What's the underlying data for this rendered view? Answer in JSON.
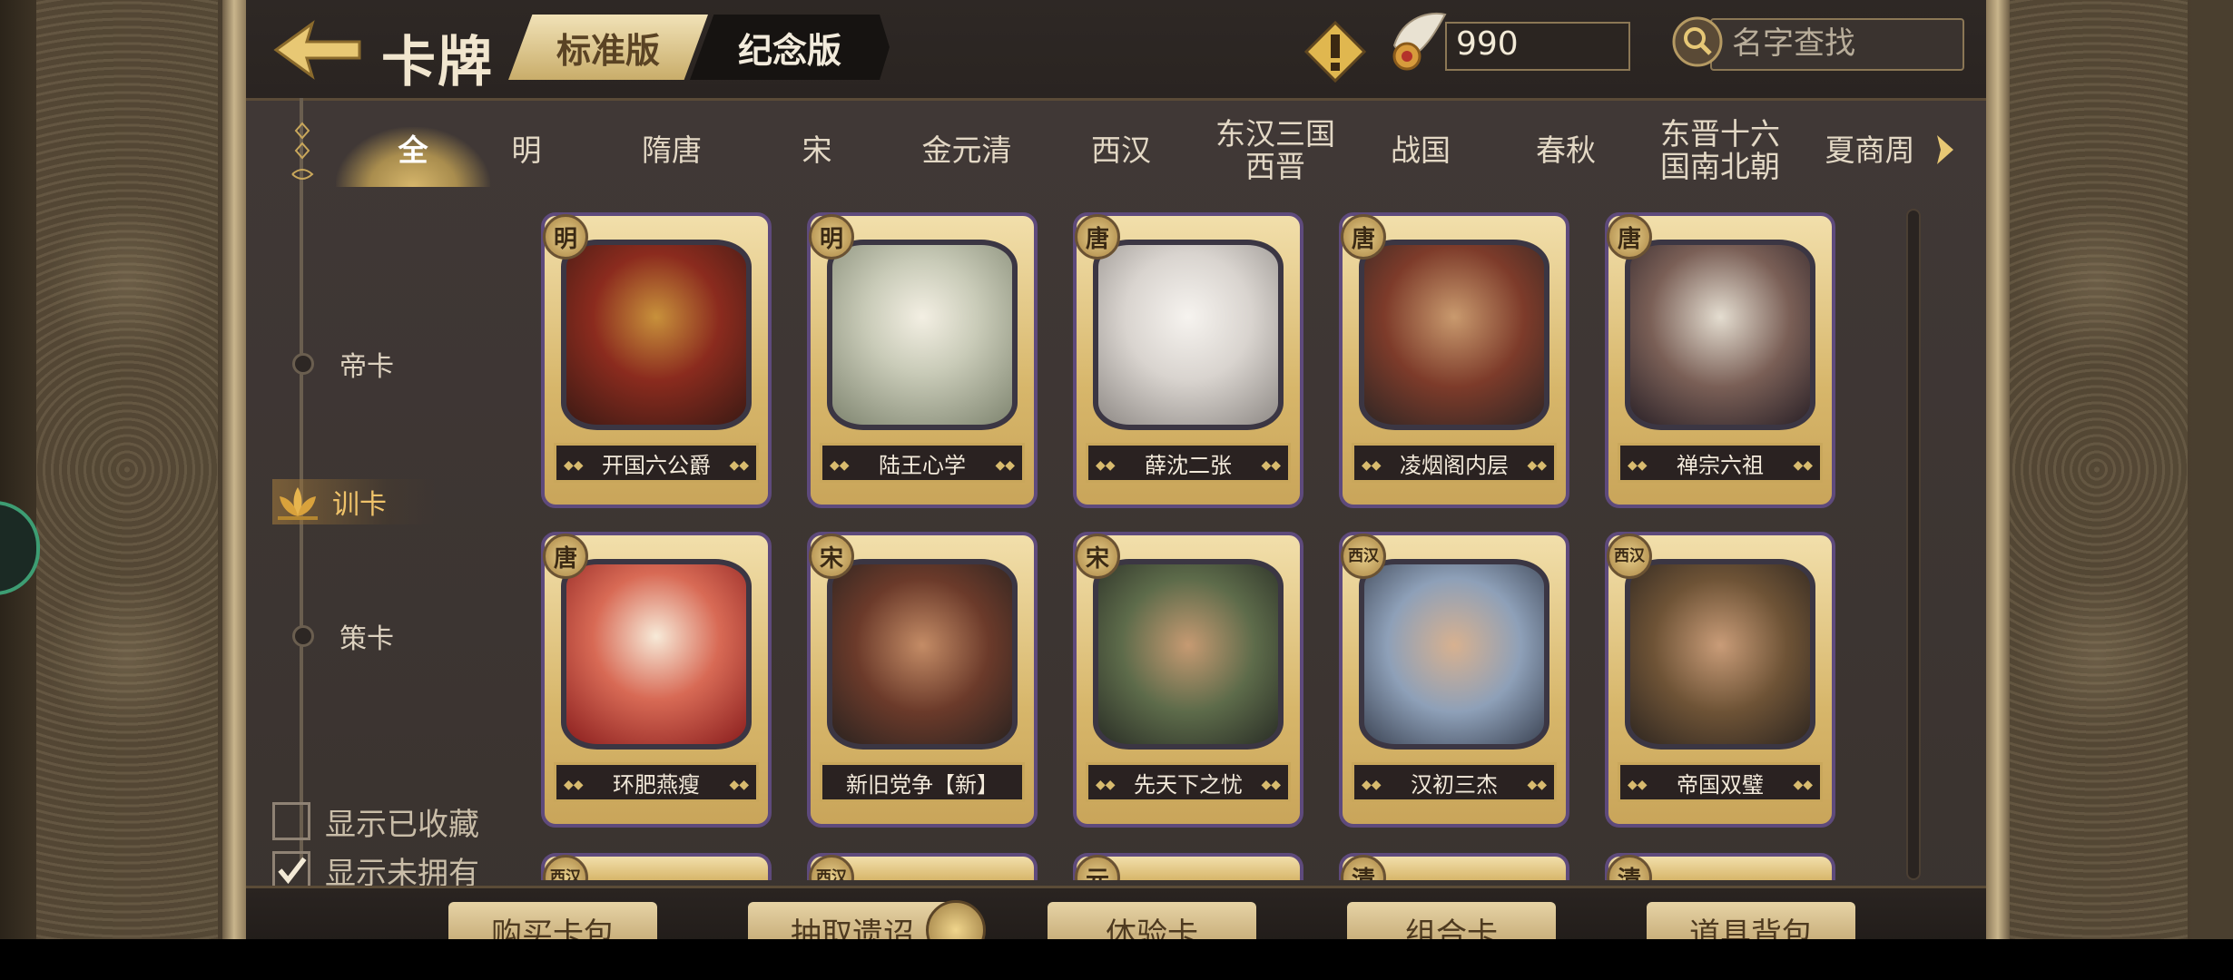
{
  "header": {
    "title": "卡牌",
    "version_tabs": [
      {
        "label": "标准版",
        "active": true
      },
      {
        "label": "纪念版",
        "active": false
      }
    ],
    "currency_value": "990",
    "search_placeholder": "名字查找"
  },
  "eras": [
    {
      "label": "全",
      "active": true
    },
    {
      "label": "明"
    },
    {
      "label": "隋唐"
    },
    {
      "label": "宋"
    },
    {
      "label": "金元清"
    },
    {
      "label": "西汉"
    },
    {
      "label": "东汉三国\n西晋"
    },
    {
      "label": "战国"
    },
    {
      "label": "春秋"
    },
    {
      "label": "东晋十六\n国南北朝"
    },
    {
      "label": "夏商周"
    }
  ],
  "sidebar": {
    "categories": [
      {
        "label": "帝卡",
        "active": false
      },
      {
        "label": "训卡",
        "active": true
      },
      {
        "label": "策卡",
        "active": false
      }
    ],
    "checkboxes": [
      {
        "label": "显示已收藏",
        "checked": false
      },
      {
        "label": "显示未拥有",
        "checked": true
      }
    ]
  },
  "cards": [
    {
      "badge": "明",
      "name": "开国六公爵"
    },
    {
      "badge": "明",
      "name": "陆王心学"
    },
    {
      "badge": "唐",
      "name": "薛沈二张"
    },
    {
      "badge": "唐",
      "name": "凌烟阁内层"
    },
    {
      "badge": "唐",
      "name": "禅宗六祖"
    },
    {
      "badge": "唐",
      "name": "环肥燕瘦"
    },
    {
      "badge": "宋",
      "name": "新旧党争【新】"
    },
    {
      "badge": "宋",
      "name": "先天下之忧"
    },
    {
      "badge": "西汉",
      "name": "汉初三杰"
    },
    {
      "badge": "西汉",
      "name": "帝国双璧"
    }
  ],
  "partial_cards": [
    {
      "badge": "西汉"
    },
    {
      "badge": "西汉"
    },
    {
      "badge": "元"
    },
    {
      "badge": "清"
    },
    {
      "badge": "清"
    }
  ],
  "bottom_buttons": [
    {
      "label": "购买卡包"
    },
    {
      "label": "抽取遗诏"
    },
    {
      "label": "体验卡"
    },
    {
      "label": "组合卡"
    },
    {
      "label": "道具背包"
    }
  ],
  "colors": {
    "gold": "#d7b66a",
    "card_border": "#5e4a7c",
    "active_category": "#f0c36a",
    "panel_bg": "#3b3431"
  }
}
